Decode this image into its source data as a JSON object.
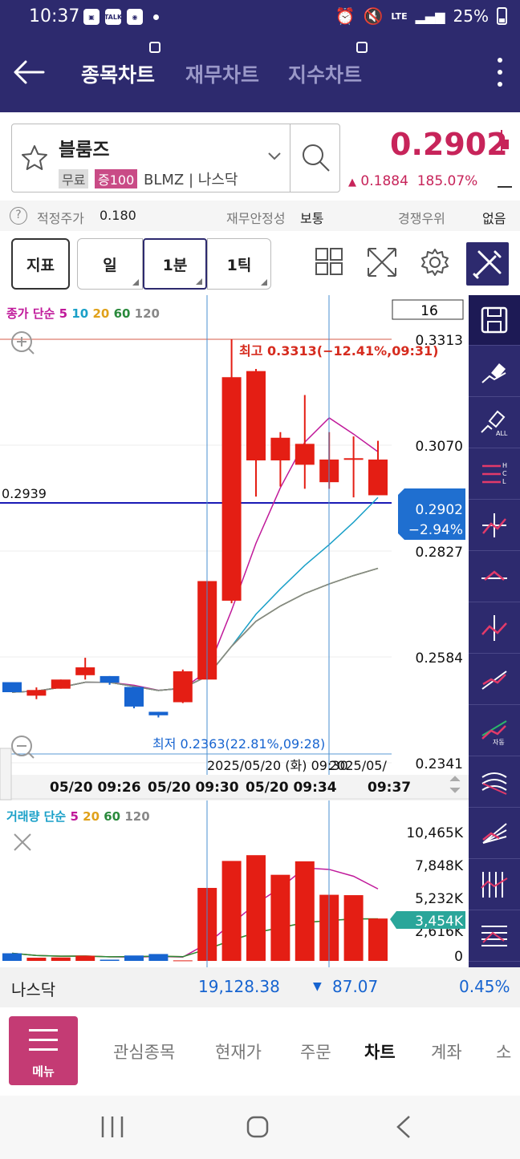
{
  "status": {
    "time": "10:37",
    "lte": "LTE",
    "battery": "25%",
    "talk": "TALK"
  },
  "header": {
    "tabs": [
      "종목차트",
      "재무차트",
      "지수차트"
    ],
    "active_tab": 0
  },
  "stock": {
    "name": "블룸즈",
    "badge_free": "무료",
    "badge_margin": "증100",
    "ticker": "BLMZ",
    "market": "나스닥"
  },
  "price": {
    "current": "0.2902",
    "change_arrow": "▲",
    "change": "0.1884",
    "change_pct": "185.07%",
    "color": "#c7245a"
  },
  "info": {
    "fair_price_label": "적정주가",
    "fair_price": "0.180",
    "fin_label": "재무안정성",
    "fin_value": "보통",
    "comp_label": "경쟁우위",
    "comp_value": "없음"
  },
  "toolbar": {
    "indicator": "지표",
    "period_day": "일",
    "period_1min": "1분",
    "period_tick": "1틱"
  },
  "chart": {
    "count_box": "16",
    "ma_label": {
      "prefix": "종가 단순",
      "p5": "5",
      "p10": "10",
      "p20": "20",
      "p60": "60",
      "p120": "120"
    },
    "high_annotation": "최고 0.3313(−12.41%,09:31)",
    "low_annotation": "최저 0.2363(22.81%,09:28)",
    "left_price_label": "0.2939",
    "current_tag": {
      "price": "0.2902",
      "pct": "−2.94%"
    },
    "y_ticks": [
      "0.3313",
      "0.3070",
      "0.2827",
      "0.2584",
      "0.2341"
    ],
    "crosshair_date_1": "2025/05/20 (화) 09:30",
    "crosshair_date_2": "2025/05/",
    "x_labels": [
      "05/20 09:26",
      "05/20 09:30",
      "05/20 09:34",
      "09:37"
    ],
    "vol_label": {
      "prefix": "거래량 단순",
      "p5": "5",
      "p20": "20",
      "p60": "60",
      "p120": "120"
    },
    "vol_ticks": [
      "10,465K",
      "7,848K",
      "5,232K",
      "2,616K",
      "0"
    ],
    "vol_current_tag": "3,454K"
  },
  "chart_data": {
    "type": "candlestick",
    "title": "",
    "interval": "1분",
    "ylim": [
      0.2341,
      0.3313
    ],
    "candles": [
      {
        "open": 0.2526,
        "close": 0.2503,
        "high": 0.2526,
        "low": 0.2503
      },
      {
        "open": 0.2495,
        "close": 0.2508,
        "high": 0.2514,
        "low": 0.2487
      },
      {
        "open": 0.2511,
        "close": 0.2532,
        "high": 0.2532,
        "low": 0.2511
      },
      {
        "open": 0.2542,
        "close": 0.256,
        "high": 0.2582,
        "low": 0.2532
      },
      {
        "open": 0.254,
        "close": 0.2525,
        "high": 0.254,
        "low": 0.252
      },
      {
        "open": 0.2515,
        "close": 0.247,
        "high": 0.2515,
        "low": 0.2466
      },
      {
        "open": 0.2458,
        "close": 0.245,
        "high": 0.2458,
        "low": 0.2445
      },
      {
        "open": 0.248,
        "close": 0.2551,
        "high": 0.2555,
        "low": 0.2478
      },
      {
        "open": 0.2532,
        "close": 0.2758,
        "high": 0.2758,
        "low": 0.2532
      },
      {
        "open": 0.2713,
        "close": 0.3226,
        "high": 0.3313,
        "low": 0.2707
      },
      {
        "open": 0.3035,
        "close": 0.324,
        "high": 0.3245,
        "low": 0.2952
      },
      {
        "open": 0.3035,
        "close": 0.3087,
        "high": 0.31,
        "low": 0.2975
      },
      {
        "open": 0.3025,
        "close": 0.3073,
        "high": 0.3185,
        "low": 0.297
      },
      {
        "open": 0.2985,
        "close": 0.3037,
        "high": 0.31,
        "low": 0.297
      },
      {
        "open": 0.3037,
        "close": 0.304,
        "high": 0.309,
        "low": 0.295
      },
      {
        "open": 0.2955,
        "close": 0.3037,
        "high": 0.308,
        "low": 0.2955
      }
    ],
    "volume": [
      620,
      260,
      280,
      420,
      100,
      440,
      560,
      40,
      5950,
      8150,
      8620,
      7020,
      8120,
      5390,
      5360,
      3454
    ],
    "ma_series": [
      {
        "name": "5",
        "color": "#c0199a"
      },
      {
        "name": "10",
        "color": "#1aa0c8"
      },
      {
        "name": "20",
        "color": "#e0a11a"
      },
      {
        "name": "60",
        "color": "#2a8a3c"
      },
      {
        "name": "120",
        "color": "#888888"
      }
    ],
    "colors": {
      "up": "#e41e14",
      "down": "#1764d0"
    }
  },
  "nasdaq": {
    "name": "나스닥",
    "value": "19,128.38",
    "arrow": "▼",
    "change": "87.07",
    "pct": "0.45%"
  },
  "nav": {
    "menu": "메뉴",
    "items": [
      "관심종목",
      "현재가",
      "주문",
      "차트",
      "계좌",
      "소"
    ]
  }
}
